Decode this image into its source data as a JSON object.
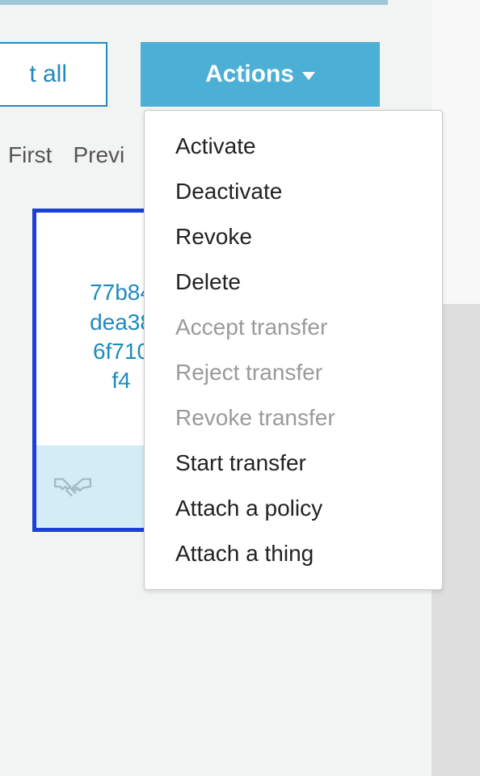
{
  "topbar": {
    "select_all_label": "t all",
    "actions_label": "Actions"
  },
  "pager": {
    "first": "First",
    "previous": "Previ"
  },
  "card": {
    "line1": "77b84",
    "line2": "dea38",
    "line3": "6f710",
    "line4": "f4"
  },
  "dropdown": {
    "items": [
      {
        "label": "Activate",
        "enabled": true
      },
      {
        "label": "Deactivate",
        "enabled": true
      },
      {
        "label": "Revoke",
        "enabled": true
      },
      {
        "label": "Delete",
        "enabled": true
      },
      {
        "label": "Accept transfer",
        "enabled": false
      },
      {
        "label": "Reject transfer",
        "enabled": false
      },
      {
        "label": "Revoke transfer",
        "enabled": false
      },
      {
        "label": "Start transfer",
        "enabled": true
      },
      {
        "label": "Attach a policy",
        "enabled": true
      },
      {
        "label": "Attach a thing",
        "enabled": true
      }
    ]
  }
}
